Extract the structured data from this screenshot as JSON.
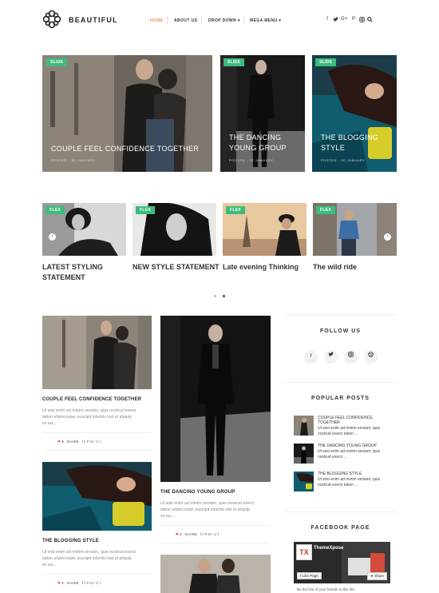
{
  "header": {
    "logo": "BEAUTIFUL",
    "nav": [
      "HOME",
      "ABOUT US",
      "DROP DOWN ▾",
      "MEGA MENU ▾"
    ],
    "social": [
      "f",
      "𝕥",
      "G+",
      "P",
      "◎",
      "search-icon"
    ]
  },
  "slider": [
    {
      "tag": "SLIDE",
      "title": "COUPLE FEEL CONFIDENCE TOGETHER",
      "meta": "POSTED - 30 JANUARY"
    },
    {
      "tag": "SLIDE",
      "title_l1": "THE DANCING",
      "title_l2": "YOUNG GROUP",
      "meta": "POSTED - 30 JANUARY"
    },
    {
      "tag": "SLIDE",
      "title_l1": "THE BLOGGING",
      "title_l2": "STYLE",
      "meta": "POSTED - 30 JANUARY"
    }
  ],
  "carousel": [
    {
      "tag": "FLEX",
      "title_l1": "LATEST STYLING",
      "title_l2": "STATEMENT"
    },
    {
      "tag": "FLEX",
      "title_l1": "NEW STYLE STATEMENT"
    },
    {
      "tag": "FLEX",
      "title_l1": "Late evening Thinking"
    },
    {
      "tag": "FLEX",
      "title_l1": "The wild ride"
    }
  ],
  "posts": [
    {
      "title": "COUPLE FEEL CONFIDENCE TOGETHER",
      "text_l1": "Ut wisi enim ad minim veniam, quis nostrud exerci",
      "text_l2": "tation ullamcorper suscipit lobortis nisl ut aliquip",
      "text_l3": "ex ea...",
      "count": "3",
      "share": "SHARE"
    },
    {
      "title": "THE DANCING YOUNG GROUP",
      "text_l1": "Ut wisi enim ad minim veniam, quis nostrud exerci",
      "text_l2": "tation ullamcorper suscipit lobortis nisl ut aliquip",
      "text_l3": "ex ea...",
      "count": "1",
      "share": "SHARE"
    },
    {
      "title": "THE BLOGGING STYLE",
      "text_l1": "Ut wisi enim ad minim veniam, quis nostrud exerci",
      "text_l2": "tation ullamcorper suscipit lobortis nisl ut aliquip",
      "text_l3": "ex ea...",
      "count": "1",
      "share": "SHARE"
    }
  ],
  "share_icons": "f  𝕥  P  G+  Ѵ  t",
  "sidebar": {
    "follow_title": "FOLLOW US",
    "follow_icons": [
      "f",
      "𝕥",
      "◎",
      "◍"
    ],
    "popular_title": "POPULAR POSTS",
    "popular": [
      {
        "t1": "COUPLE FEEL CONFIDENCE",
        "t2": "TOGETHER",
        "x1": "Ut wisi enim ad minim veniam, quis",
        "x2": "nostrud exerci tation ..."
      },
      {
        "t1": "THE DANCING YOUNG GROUP",
        "t2": "",
        "x1": "Ut wisi enim ad minim veniam, quis",
        "x2": "nostrud exerci ..."
      },
      {
        "t1": "THE BLOGGING STYLE",
        "t2": "",
        "x1": "Ut wisi enim ad minim veniam, quis",
        "x2": "nostrud exerci tation ..."
      }
    ],
    "facebook_title": "FACEBOOK PAGE",
    "fb_page_name": "ThemeXpose",
    "fb_like": "Like Page",
    "fb_share": "Share",
    "fb_footer": "Be the first of your friends to like this"
  },
  "colors": {
    "accent": "#e0915a",
    "tag": "#3dbc7c",
    "share_count": "#e33b3b"
  }
}
